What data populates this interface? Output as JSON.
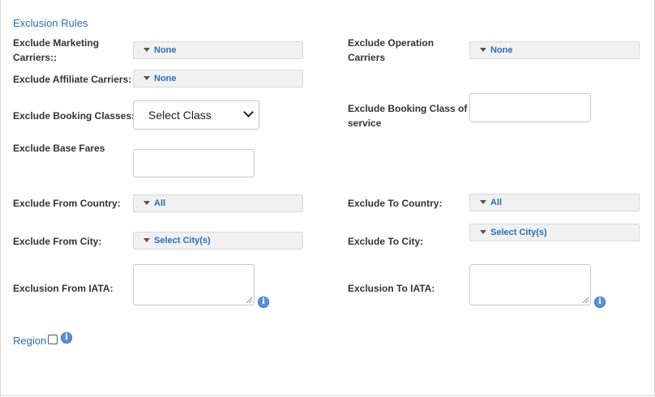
{
  "section_title": "Exclusion Rules",
  "labels": {
    "marketing_1": "Exclude Marketing",
    "marketing_2": "Carriers::",
    "operation_1": "Exclude Operation",
    "operation_2": "Carriers",
    "affiliate": "Exclude Affiliate Carriers:",
    "booking_classes": "Exclude Booking Classes:",
    "booking_class_service_1": "Exclude Booking Class of",
    "booking_class_service_2": "service",
    "base_fares": "Exclude Base Fares",
    "from_country": "Exclude From Country:",
    "to_country": "Exclude To Country:",
    "from_city": "Exclude From City:",
    "to_city": "Exclude To City:",
    "from_iata": "Exclusion From IATA:",
    "to_iata": "Exclusion To IATA:"
  },
  "dropdowns": {
    "marketing": "None",
    "operation": "None",
    "affiliate": "None",
    "from_country": "All",
    "to_country": "All",
    "from_city": "Select City(s)",
    "to_city": "Select City(s)"
  },
  "booking_class_select": "Select Class",
  "info_glyph": "i",
  "region_label": "Region"
}
